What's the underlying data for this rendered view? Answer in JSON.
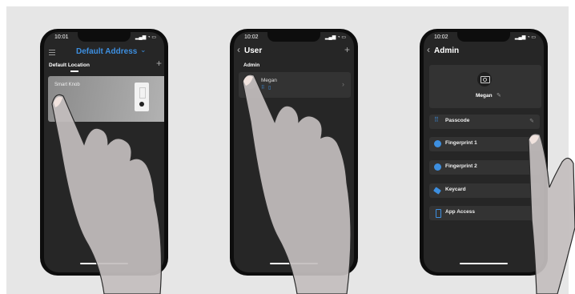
{
  "phone1": {
    "status_time": "10:01",
    "menu_icon": "menu-icon",
    "title": "Default Address",
    "title_chevron": "⌄",
    "location_label": "Default Location",
    "add_icon": "plus-icon",
    "device_name": "Smart Knob"
  },
  "phone2": {
    "status_time": "10:02",
    "back": "‹",
    "title": "User",
    "add_icon": "plus-icon",
    "section": "Admin",
    "user_name": "Megan",
    "chevron": "›"
  },
  "phone3": {
    "status_time": "10:02",
    "back": "‹",
    "title": "Admin",
    "camera_icon": "camera-icon",
    "user_name": "Megan",
    "rows": [
      {
        "label": "Passcode",
        "icon": "keypad-icon"
      },
      {
        "label": "Fingerprint 1",
        "icon": "fingerprint-icon"
      },
      {
        "label": "Fingerprint 2",
        "icon": "fingerprint-icon"
      },
      {
        "label": "Keycard",
        "icon": "keycard-icon"
      },
      {
        "label": "App Access",
        "icon": "phone-icon"
      }
    ]
  },
  "colors": {
    "accent_blue": "#3d8fe0",
    "screen_bg": "#262626",
    "row_bg": "#333333",
    "hand_fill": "#c3bdbd"
  }
}
